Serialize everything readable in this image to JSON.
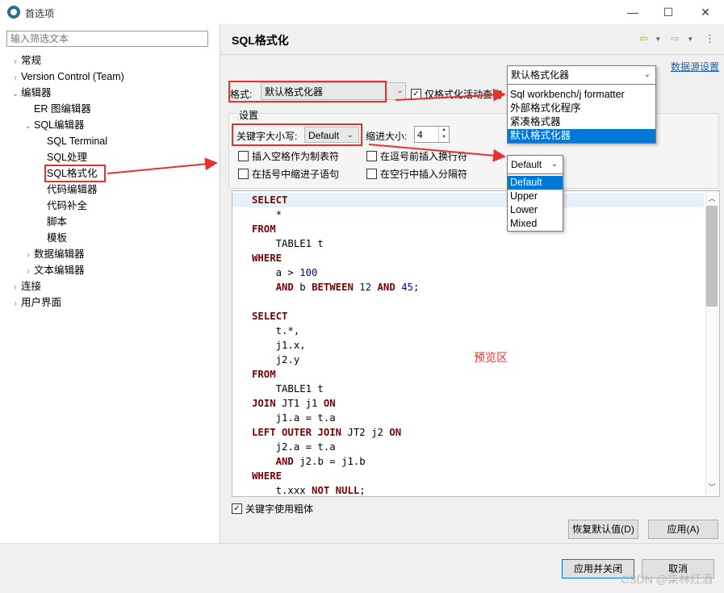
{
  "window": {
    "title": "首选项",
    "minimize": "—",
    "maximize": "☐",
    "close": "✕"
  },
  "sidebar": {
    "filter_placeholder": "输入筛选文本",
    "items": [
      {
        "label": "常规",
        "chev": "›"
      },
      {
        "label": "Version Control (Team)",
        "chev": "›"
      },
      {
        "label": "编辑器",
        "chev": "⌄"
      },
      {
        "label": "ER 图编辑器",
        "chev": ""
      },
      {
        "label": "SQL编辑器",
        "chev": "⌄"
      },
      {
        "label": "SQL Terminal",
        "chev": ""
      },
      {
        "label": "SQL处理",
        "chev": ""
      },
      {
        "label": "SQL格式化",
        "chev": ""
      },
      {
        "label": "代码编辑器",
        "chev": ""
      },
      {
        "label": "代码补全",
        "chev": ""
      },
      {
        "label": "脚本",
        "chev": ""
      },
      {
        "label": "模板",
        "chev": ""
      },
      {
        "label": "数据编辑器",
        "chev": "›"
      },
      {
        "label": "文本编辑器",
        "chev": "›"
      },
      {
        "label": "连接",
        "chev": "›"
      },
      {
        "label": "用户界面",
        "chev": "›"
      }
    ]
  },
  "header": {
    "title": "SQL格式化",
    "back_icon": "⇦",
    "forward_icon": "⇨",
    "dropdown_icon": "▾",
    "menu_icon": "⋮",
    "datasource_link": "数据源设置"
  },
  "format": {
    "label": "格式:",
    "value": "默认格式化器",
    "active_only_label": "仅格式化活动查询",
    "active_only_checked": true
  },
  "settings": {
    "group_label": "设置",
    "keyword_case_label": "关键字大小写:",
    "keyword_case_value": "Default",
    "indent_label": "缩进大小:",
    "indent_value": "4",
    "options": [
      {
        "label": "插入空格作为制表符",
        "checked": false
      },
      {
        "label": "在逗号前插入换行符",
        "checked": false
      },
      {
        "label": "在括号中缩进子语句",
        "checked": false
      },
      {
        "label": "在空行中插入分隔符",
        "checked": false
      }
    ]
  },
  "preview": {
    "annotation": "预览区"
  },
  "bold_keywords": {
    "label": "关键字使用粗体",
    "checked": true
  },
  "buttons": {
    "restore_defaults": "恢复默认值(D)",
    "apply": "应用(A)",
    "apply_close": "应用并关闭",
    "cancel": "取消"
  },
  "format_dropdown": {
    "current": "默认格式化器",
    "options": [
      "Sql workbench/j formatter",
      "外部格式化程序",
      "紧凑格式器",
      "默认格式化器"
    ],
    "selected_index": 3
  },
  "case_dropdown": {
    "current": "Default",
    "options": [
      "Default",
      "Upper",
      "Lower",
      "Mixed"
    ],
    "selected_index": 0
  },
  "watermark": "CSDN @柒林红酒",
  "colors": {
    "annotation_red": "#e5322d",
    "selection_blue": "#0078d7",
    "sql_keyword": "#7f0000",
    "sql_number": "#0000c0",
    "link": "#1a5fb4"
  }
}
